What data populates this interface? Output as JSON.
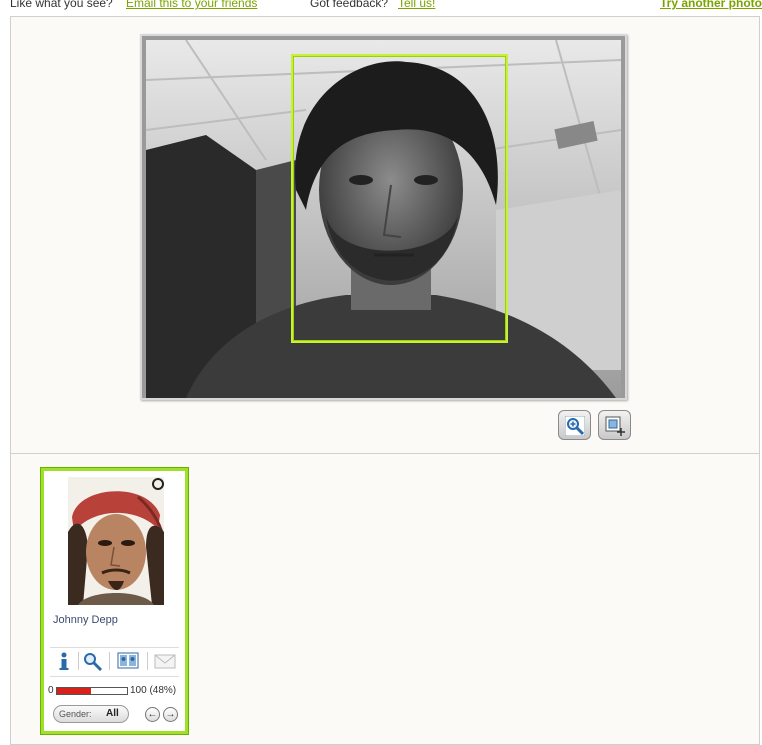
{
  "topbar": {
    "like_text": "Like what you see?",
    "email_link": "Email this to your friends",
    "feedback_text": "Got feedback?",
    "tell_link": "Tell us!",
    "try_link": "Try another photo"
  },
  "colors": {
    "accent_green": "#9fe02a",
    "link_green": "#7aa300",
    "face_box": "#c7f03a",
    "score_fill": "#d8211a"
  },
  "match": {
    "name": "Johnny Depp",
    "score_min": "0",
    "score_max_label": "100 (48%)",
    "score_fraction": 0.48,
    "gender_label": "Gender:",
    "gender_value": "All",
    "prev_label": "←",
    "next_label": "→"
  },
  "icons": {
    "zoom_in": "zoom-in-icon",
    "fit": "fit-photo-icon",
    "info": "info-icon",
    "search": "magnify-icon",
    "compare": "compare-faces-icon",
    "email": "envelope-icon"
  }
}
